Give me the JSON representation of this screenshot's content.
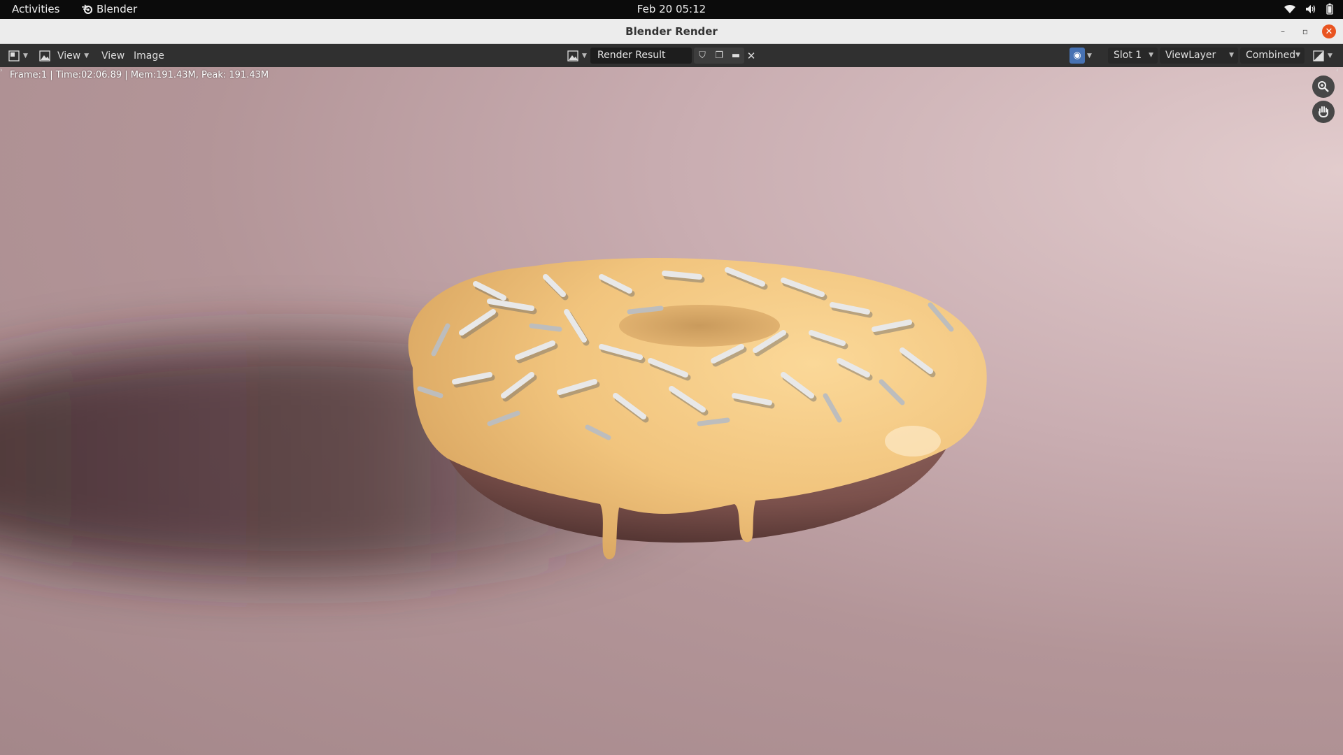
{
  "topbar": {
    "activities": "Activities",
    "app_name": "Blender",
    "clock": "Feb 20  05:12",
    "tray_icons": [
      "wifi-icon",
      "volume-icon",
      "battery-icon"
    ]
  },
  "window": {
    "title": "Blender Render",
    "controls": [
      "minimize",
      "maximize",
      "close"
    ]
  },
  "header": {
    "view_dropdown": "View",
    "menus": [
      "View",
      "Image"
    ],
    "image_name": "Render Result",
    "slot": "Slot 1",
    "view_layer": "ViewLayer",
    "render_pass": "Combined"
  },
  "viewport": {
    "status": "Frame:1 | Time:02:06.89 | Mem:191.43M, Peak: 191.43M",
    "subject": "donut with cream glaze and white sprinkles",
    "colors": {
      "background": "#b8999c",
      "glaze": "#f1c680",
      "dough": "#7c5350",
      "sprinkles": "#e6e6e6"
    }
  }
}
